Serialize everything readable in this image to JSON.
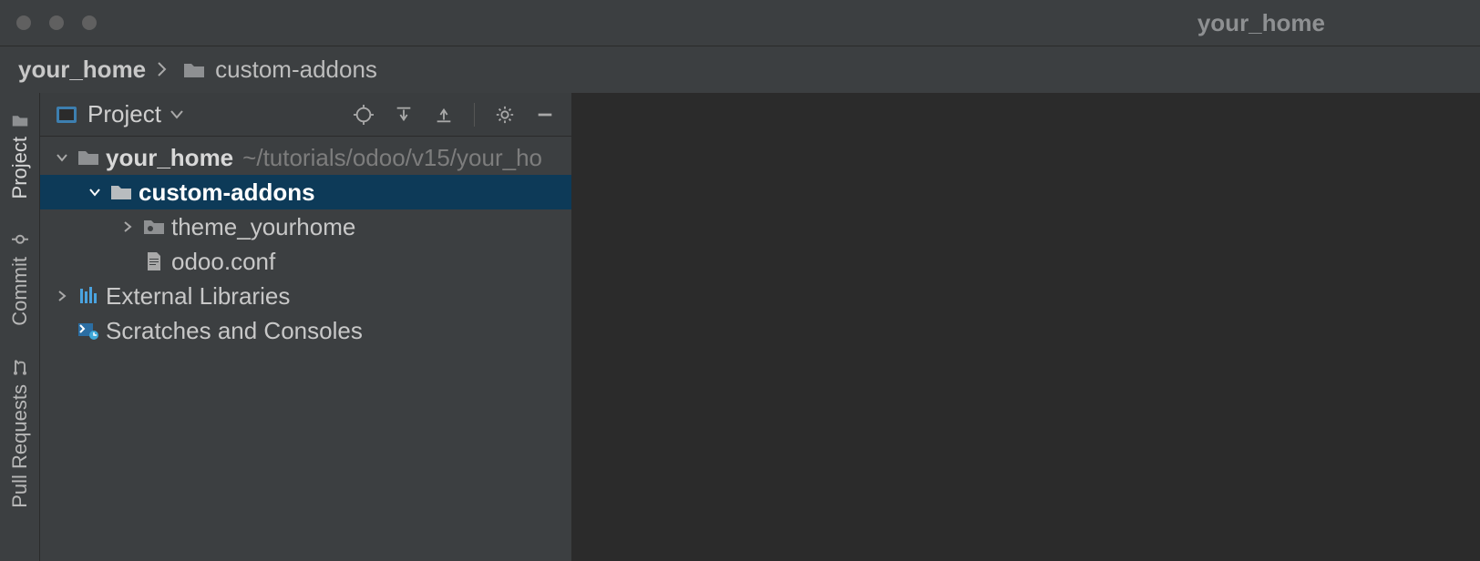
{
  "window": {
    "title": "your_home"
  },
  "breadcrumb": {
    "root": "your_home",
    "child": "custom-addons"
  },
  "leftTabs": {
    "project": "Project",
    "commit": "Commit",
    "pull": "Pull Requests"
  },
  "projectPanel": {
    "title": "Project"
  },
  "tree": {
    "root": {
      "name": "your_home",
      "path": "~/tutorials/odoo/v15/your_ho"
    },
    "customAddons": "custom-addons",
    "themeYourhome": "theme_yourhome",
    "odooConf": "odoo.conf",
    "external": "External Libraries",
    "scratches": "Scratches and Consoles"
  }
}
